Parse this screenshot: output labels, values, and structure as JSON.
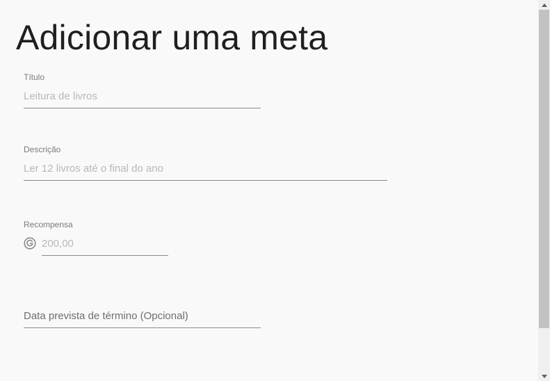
{
  "page": {
    "title": "Adicionar uma meta"
  },
  "form": {
    "titulo": {
      "label": "Título",
      "placeholder": "Leitura de livros",
      "value": ""
    },
    "descricao": {
      "label": "Descrição",
      "placeholder": "Ler 12 livros até o final do ano",
      "value": ""
    },
    "recompensa": {
      "label": "Recompensa",
      "placeholder": "200,00",
      "value": "",
      "icon": "coin-icon"
    },
    "data": {
      "placeholder": "Data prevista de término (Opcional)",
      "value": ""
    }
  },
  "colors": {
    "background": "#f9f9f9",
    "title_text": "#1f1f1f",
    "underline": "#8a8a8a",
    "scrollbar_thumb": "#c2c2c2"
  }
}
